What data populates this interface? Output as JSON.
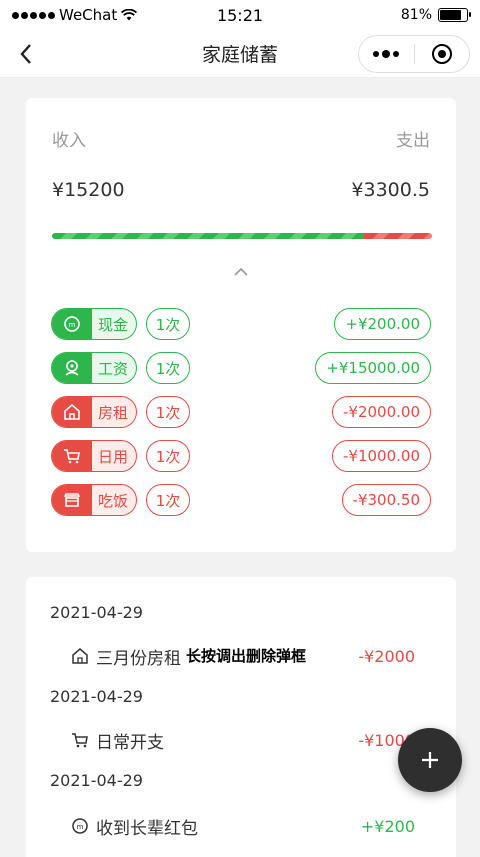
{
  "status_bar": {
    "carrier": "WeChat",
    "time": "15:21",
    "battery_percent_label": "81%",
    "battery_level": 0.81
  },
  "nav": {
    "title": "家庭储蓄"
  },
  "summary": {
    "income_label": "收入",
    "expense_label": "支出",
    "income_amount": "¥15200",
    "expense_amount": "¥3300.5",
    "income_share": 0.82,
    "colors": {
      "income": "#2cb64b",
      "expense": "#e64b44"
    }
  },
  "categories": [
    {
      "icon": "cash-coin-icon",
      "label": "现金",
      "count": "1次",
      "amount": "+¥200.00",
      "type": "income"
    },
    {
      "icon": "salary-icon",
      "label": "工资",
      "count": "1次",
      "amount": "+¥15000.00",
      "type": "income"
    },
    {
      "icon": "home-icon",
      "label": "房租",
      "count": "1次",
      "amount": "-¥2000.00",
      "type": "expense"
    },
    {
      "icon": "cart-icon",
      "label": "日用",
      "count": "1次",
      "amount": "-¥1000.00",
      "type": "expense"
    },
    {
      "icon": "restaurant-icon",
      "label": "吃饭",
      "count": "1次",
      "amount": "-¥300.50",
      "type": "expense"
    }
  ],
  "records": [
    {
      "date": "2021-04-29",
      "icon": "home-icon",
      "title": "三月份房租",
      "amount": "-¥2000",
      "hint": "长按调出删除弹框"
    },
    {
      "date": "2021-04-29",
      "icon": "cart-icon",
      "title": "日常开支",
      "amount": "-¥1000"
    },
    {
      "date": "2021-04-29",
      "icon": "cash-coin-icon",
      "title": "收到长辈红包",
      "amount": "+¥200"
    }
  ],
  "fab": {
    "icon": "plus-icon"
  }
}
